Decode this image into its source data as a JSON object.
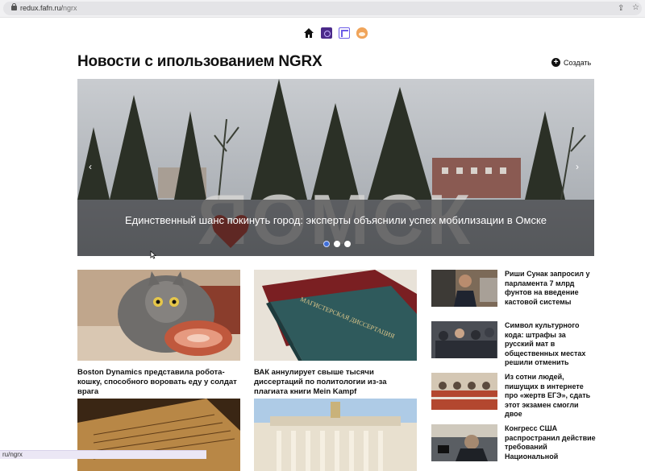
{
  "browser": {
    "url_host": "redux.fafn.ru/",
    "url_path": "ngrx"
  },
  "nav": {
    "icons": [
      "home-icon",
      "redux-icon",
      "ngrx-icon",
      "shiba-icon"
    ]
  },
  "page": {
    "title": "Новости с ипользованием NGRX",
    "create_label": "Создать"
  },
  "carousel": {
    "caption": "Единственный шанс покинуть город: эксперты объяснили успех мобилизации в Омске",
    "sign_text": "ЯОМСК",
    "prev_label": "‹",
    "next_label": "›",
    "active_slide": 1,
    "slide_count": 3
  },
  "cards": [
    {
      "title": "Boston Dynamics представила робота-кошку, способного воровать еду у солдат врага"
    },
    {
      "title": "ВАК аннулирует свыше тысячи диссертаций по политологии из-за плагиата книги Mein Kampf",
      "book_text": "МАГИСТЕРСКАЯ ДИССЕРТАЦИЯ"
    }
  ],
  "side_news": [
    {
      "title": "Риши Сунак запросил у парламента 7 млрд фунтов на введение кастовой системы"
    },
    {
      "title": "Символ культурного кода: штрафы за русский мат в общественных местах решили отменить"
    },
    {
      "title": "Из сотни людей, пишущих в интернете про «жертв ЕГЭ», сдать этот экзамен смогли двое"
    },
    {
      "title": "Конгресс США распространил действие требований Национальной"
    }
  ],
  "status_bar": {
    "text": "ru/ngrx"
  },
  "colors": {
    "accent": "#3f6fd8",
    "text": "#111111",
    "caption_band": "#19191c"
  }
}
